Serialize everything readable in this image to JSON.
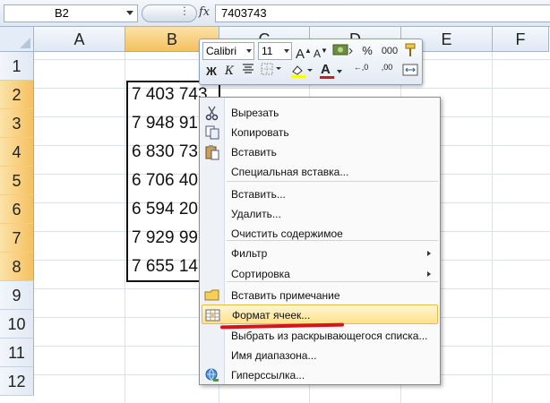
{
  "formula_bar": {
    "name_box": "B2",
    "fx": "fx",
    "value": "7403743"
  },
  "columns": [
    "A",
    "B",
    "C",
    "D",
    "E",
    "F"
  ],
  "selected_column": "B",
  "rows": [
    "1",
    "2",
    "3",
    "4",
    "5",
    "6",
    "7",
    "8",
    "9",
    "10",
    "11",
    "12"
  ],
  "cells_B": [
    "7 403 743",
    "7 948 91",
    "6 830 73",
    "6 706 40",
    "6 594 20",
    "7 929 99",
    "7 655 14"
  ],
  "mini_toolbar": {
    "font": "Calibri",
    "size": "11",
    "grow": "A",
    "shrink": "A",
    "percent": "%",
    "thousands": "000",
    "bold": "Ж",
    "italic": "К",
    "font_color_letter": "A",
    "dec_increase": "←,0",
    "dec_decrease": ",00"
  },
  "context_menu": {
    "items": [
      {
        "label": "Вырезать",
        "icon": "scissors-icon"
      },
      {
        "label": "Копировать",
        "icon": "copy-icon"
      },
      {
        "label": "Вставить",
        "icon": "paste-icon"
      },
      {
        "label": "Специальная вставка...",
        "icon": ""
      },
      {
        "label": "Вставить...",
        "icon": ""
      },
      {
        "label": "Удалить...",
        "icon": ""
      },
      {
        "label": "Очистить содержимое",
        "icon": ""
      },
      {
        "label": "Фильтр",
        "icon": "",
        "submenu": true
      },
      {
        "label": "Сортировка",
        "icon": "",
        "submenu": true
      },
      {
        "label": "Вставить примечание",
        "icon": "comment-icon"
      },
      {
        "label": "Формат ячеек...",
        "icon": "format-cells-icon",
        "highlighted": true
      },
      {
        "label": "Выбрать из раскрывающегося списка...",
        "icon": ""
      },
      {
        "label": "Имя диапазона...",
        "icon": ""
      },
      {
        "label": "Гиперссылка...",
        "icon": "hyperlink-icon"
      }
    ]
  },
  "colors": {
    "selection_header": "#f5c15f",
    "menu_highlight": "#ffe28a",
    "annotation": "#d7141a"
  }
}
